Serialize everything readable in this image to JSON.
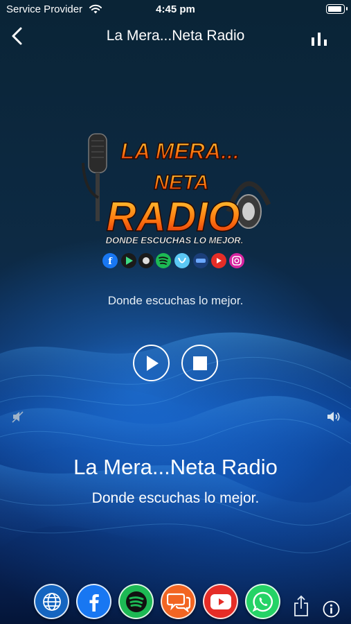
{
  "status_bar": {
    "carrier": "Service Provider",
    "time": "4:45 pm"
  },
  "nav": {
    "title": "La Mera...Neta Radio"
  },
  "logo": {
    "line1": "LA MERA...",
    "line2": "NETA",
    "line3": "RADIO",
    "slogan": "DONDE ESCUCHAS LO MEJOR."
  },
  "station": {
    "tagline_top": "Donde escuchas lo mejor.",
    "name": "La Mera...Neta Radio",
    "tagline": "Donde escuchas lo mejor."
  },
  "player": {
    "controls": [
      "play-icon",
      "stop-icon"
    ],
    "volume_icons": [
      "volume-min-icon",
      "volume-max-icon"
    ]
  },
  "social_links": [
    {
      "name": "website",
      "icon": "globe-icon",
      "color": "#1565c0"
    },
    {
      "name": "facebook",
      "icon": "facebook-icon",
      "color": "#1877f2"
    },
    {
      "name": "spotify",
      "icon": "spotify-icon",
      "color": "#1db954"
    },
    {
      "name": "chat",
      "icon": "chat-icon",
      "color": "#f26522"
    },
    {
      "name": "youtube",
      "icon": "youtube-icon",
      "color": "#e52d27"
    },
    {
      "name": "whatsapp",
      "icon": "whatsapp-icon",
      "color": "#25d366"
    }
  ],
  "colors": {
    "background_top": "#0a2436",
    "background_wave": "#1e7fe8",
    "text": "#ffffff"
  }
}
